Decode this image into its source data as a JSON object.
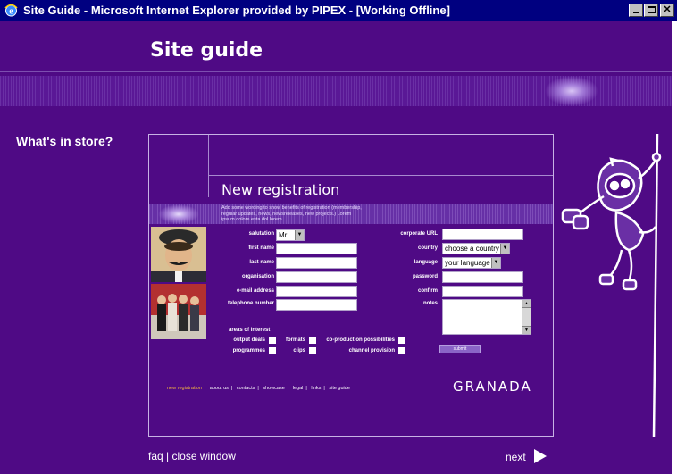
{
  "window": {
    "title": "Site Guide - Microsoft Internet Explorer provided by PIPEX - [Working Offline]"
  },
  "page": {
    "title": "Site guide",
    "sidebar_heading": "What's in store?"
  },
  "panel": {
    "heading": "New registration",
    "description": "Add some wording to show benefits of registration (membership, regular updates, news, newsreleases, new projects.) Lorem ipsum dolore esta dol lorem.",
    "form": {
      "salutation_label": "salutation",
      "salutation_value": "Mr",
      "first_name_label": "first name",
      "last_name_label": "last name",
      "organisation_label": "organisation",
      "email_label": "e-mail address",
      "telephone_label": "telephone number",
      "corporate_url_label": "corporate URL",
      "country_label": "country",
      "country_value": "choose a country",
      "language_label": "language",
      "language_value": "your language",
      "password_label": "password",
      "confirm_label": "confirm",
      "notes_label": "notes",
      "areas_heading": "areas of interest",
      "interests": {
        "output_deals": "output deals",
        "formats": "formats",
        "coproduction": "co-production possibilities",
        "programmes": "programmes",
        "clips": "clips",
        "channel_provision": "channel provision"
      },
      "submit_label": "submit"
    },
    "footer_nav": {
      "new_registration": "new registration",
      "about_us": "about us",
      "contacts": "contacts",
      "showcase": "showcase",
      "legal": "legal",
      "links": "links",
      "site_guide": "site guide",
      "separator": "|"
    },
    "brand": "GRANADA"
  },
  "bottom": {
    "faq": "faq",
    "separator": "|",
    "close_window": "close window",
    "next": "next"
  },
  "colors": {
    "background": "#4f0a85",
    "titlebar": "#000080",
    "active_nav": "#f7b640"
  }
}
